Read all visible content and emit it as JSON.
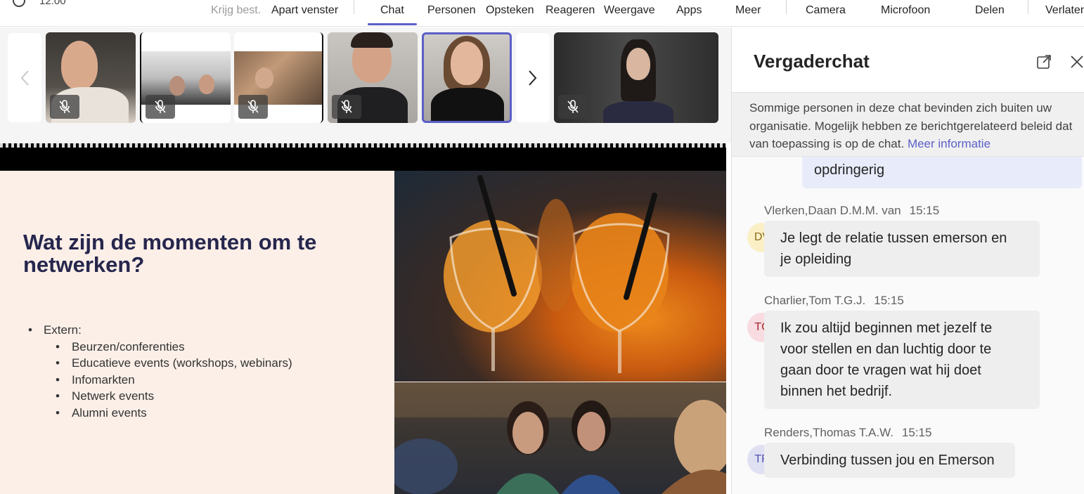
{
  "toolbar": {
    "timer": "12:00",
    "items": [
      {
        "label": "Krijg best."
      },
      {
        "label": "Apart venster"
      },
      {
        "label": "Chat"
      },
      {
        "label": "Personen"
      },
      {
        "label": "Opsteken"
      },
      {
        "label": "Reageren"
      },
      {
        "label": "Weergave"
      },
      {
        "label": "Apps"
      },
      {
        "label": "Meer"
      },
      {
        "label": "Camera"
      },
      {
        "label": "Microfoon"
      },
      {
        "label": "Delen"
      },
      {
        "label": "Verlaten"
      }
    ],
    "active_tab": "Chat",
    "accent_color": "#5b5fc7"
  },
  "video_strip": {
    "participants": [
      {
        "muted": true
      },
      {
        "muted": true
      },
      {
        "muted": true
      },
      {
        "muted": true
      },
      {
        "muted": false,
        "speaking": true
      },
      {
        "muted": true
      }
    ]
  },
  "slide": {
    "title": "Wat zijn de momenten om te netwerken?",
    "bullets": {
      "heading": "Extern:",
      "items": [
        "Beurzen/conferenties",
        "Educatieve events (workshops, webinars)",
        "Infomarkten",
        "Netwerk events",
        "Alumni events"
      ]
    }
  },
  "chat": {
    "title": "Vergaderchat",
    "notice_text": "Sommige personen in deze chat bevinden zich buiten uw organisatie. Mogelijk hebben ze berichtgerelateerd beleid dat van toepassing is op de chat.",
    "notice_link": "Meer informatie",
    "own_message": "opdringerig",
    "messages": [
      {
        "sender": "Vlerken,Daan D.M.M. van",
        "time": "15:15",
        "initials": "DV",
        "text_lines": [
          "Je legt de relatie tussen emerson en",
          "je opleiding"
        ]
      },
      {
        "sender": "Charlier,Tom T.G.J.",
        "time": "15:15",
        "initials": "TC",
        "text_lines": [
          "Ik zou altijd beginnen met jezelf te",
          "voor stellen en dan luchtig door te",
          "gaan door te vragen wat hij doet",
          "binnen het bedrijf."
        ]
      },
      {
        "sender": "Renders,Thomas T.A.W.",
        "time": "15:15",
        "initials": "TR",
        "text_lines": [
          "Verbinding tussen jou en Emerson"
        ]
      }
    ]
  }
}
